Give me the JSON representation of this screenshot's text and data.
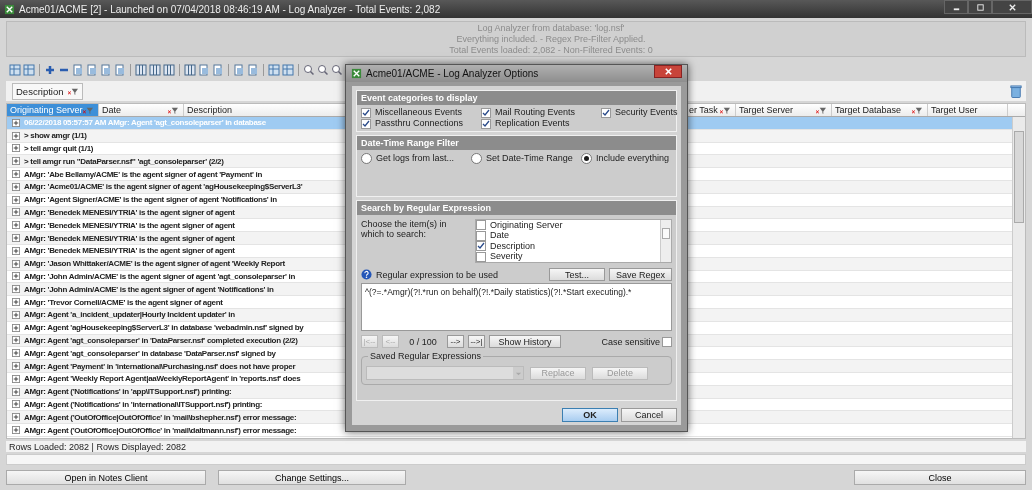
{
  "window": {
    "title": "Acme01/ACME [2] - Launched on 07/04/2018 08:46:19 AM - Log Analyzer - Total Events: 2,082"
  },
  "info": [
    "Log Analyzer from database: 'log.nsf'",
    "Everything included. - Regex Pre-Filter Applied.",
    "Total Events loaded: 2,082 - Non-Filtered Events: 0"
  ],
  "group_by": {
    "label": "Description"
  },
  "columns": [
    {
      "label": "Originating Server",
      "selected": true
    },
    {
      "label": "Date",
      "selected": false
    },
    {
      "label": "Description",
      "selected": false
    },
    {
      "label": "er Task",
      "selected": false
    },
    {
      "label": "Target Server",
      "selected": false
    },
    {
      "label": "Target Database",
      "selected": false
    },
    {
      "label": "Target User",
      "selected": false
    }
  ],
  "rows": [
    {
      "text": "06/22/2018 05:57:57 AM  AMgr: Agent 'agt_consoleparser' in database",
      "selected": true
    },
    {
      "text": "> show amgr (1/1)",
      "selected": false
    },
    {
      "text": "> tell amgr quit (1/1)",
      "selected": false
    },
    {
      "text": "> tell amgr run \"DataParser.nsf\" 'agt_consoleparser' (2/2)",
      "selected": false
    },
    {
      "text": "AMgr: 'Abe Bellamy/ACME' is the agent signer of agent 'Payment' in",
      "selected": false
    },
    {
      "text": "AMgr: 'Acme01/ACME' is the agent signer of agent 'agHousekeeping$ServerL3'",
      "selected": false
    },
    {
      "text": "AMgr: 'Agent Signer/ACME' is the agent signer of agent 'Notifications' in",
      "selected": false
    },
    {
      "text": "AMgr: 'Benedek MENESI/YTRIA' is the agent signer of agent",
      "selected": false
    },
    {
      "text": "AMgr: 'Benedek MENESI/YTRIA' is the agent signer of agent",
      "selected": false
    },
    {
      "text": "AMgr: 'Benedek MENESI/YTRIA' is the agent signer of agent",
      "selected": false
    },
    {
      "text": "AMgr: 'Benedek MENESI/YTRIA' is the agent signer of agent",
      "selected": false
    },
    {
      "text": "AMgr: 'Jason Whittaker/ACME' is the agent signer of agent 'Weekly Report",
      "selected": false
    },
    {
      "text": "AMgr: 'John Admin/ACME' is the agent signer of agent 'agt_consoleparser' in",
      "selected": false
    },
    {
      "text": "AMgr: 'John Admin/ACME' is the agent signer of agent 'Notifications' in",
      "selected": false
    },
    {
      "text": "AMgr: 'Trevor Cornell/ACME' is the agent signer of agent",
      "selected": false
    },
    {
      "text": "AMgr: Agent 'a_incident_updater|Hourly Incident updater' in",
      "selected": false
    },
    {
      "text": "AMgr: Agent 'agHousekeeping$ServerL3' in database 'webadmin.nsf' signed by",
      "selected": false
    },
    {
      "text": "AMgr: Agent 'agt_consoleparser' in 'DataParser.nsf' completed execution (2/2)",
      "selected": false
    },
    {
      "text": "AMgr: Agent 'agt_consoleparser' in database 'DataParser.nsf' signed by",
      "selected": false
    },
    {
      "text": "AMgr: Agent 'Payment' in 'international\\Purchasing.nsf' does not have proper",
      "selected": false
    },
    {
      "text": "AMgr: Agent 'Weekly Report Agent|aaWeeklyReportAgent' in 'reports.nsf' does",
      "selected": false
    },
    {
      "text": "AMgr: Agent ('Notifications' in 'app\\ITSupport.nsf') printing:",
      "selected": false
    },
    {
      "text": "AMgr: Agent ('Notifications' in 'international\\ITSupport.nsf') printing:",
      "selected": false
    },
    {
      "text": "AMgr: Agent ('OutOfOffice|OutOfOffice' in 'mail\\bshepher.nsf') error message:",
      "selected": false
    },
    {
      "text": "AMgr: Agent ('OutOfOffice|OutOfOffice' in 'mail\\daltmann.nsf') error message:",
      "selected": false
    }
  ],
  "status": "Rows Loaded: 2082 | Rows Displayed: 2082",
  "buttons": [
    "Open in Notes Client",
    "Change Settings...",
    "Close"
  ],
  "dialog": {
    "title": "Acme01/ACME - Log Analyzer Options",
    "categories": {
      "title": "Event categories to display",
      "items": [
        {
          "label": "Miscellaneous Events",
          "checked": true
        },
        {
          "label": "Mail Routing Events",
          "checked": true
        },
        {
          "label": "Security Events",
          "checked": true
        },
        {
          "label": "Passthru Connections",
          "checked": true
        },
        {
          "label": "Replication Events",
          "checked": true
        }
      ]
    },
    "date_filter": {
      "title": "Date-Time Range Filter",
      "options": [
        {
          "label": "Get logs from last...",
          "selected": false
        },
        {
          "label": "Set Date-Time Range",
          "selected": false
        },
        {
          "label": "Include everything",
          "selected": true
        }
      ]
    },
    "regex": {
      "title": "Search by Regular Expression",
      "choose_label": "Choose the item(s) in which to search:",
      "fields": [
        {
          "label": "Originating Server",
          "checked": false
        },
        {
          "label": "Date",
          "checked": false
        },
        {
          "label": "Description",
          "checked": true
        },
        {
          "label": "Severity",
          "checked": false
        }
      ],
      "expression_label": "Regular expression to be used",
      "test_button": "Test...",
      "save_button": "Save Regex",
      "expression": "^(?=.*Amgr)(?!.*run on behalf)(?!.*Daily statistics)(?!.*Start executing).*",
      "nav": [
        {
          "label": "|<--",
          "disabled": true
        },
        {
          "label": "<--",
          "disabled": true
        },
        {
          "label": "-->",
          "disabled": false
        },
        {
          "label": "-->|",
          "disabled": false
        }
      ],
      "counter": "0 / 100",
      "history_button": "Show History",
      "case_sensitive": {
        "label": "Case sensitive",
        "checked": false
      },
      "saved": {
        "title": "Saved Regular Expressions",
        "buttons": [
          {
            "label": "Replace",
            "disabled": true
          },
          {
            "label": "Delete",
            "disabled": true
          }
        ]
      }
    },
    "buttons": [
      {
        "label": "OK",
        "default": true
      },
      {
        "label": "Cancel",
        "default": false
      }
    ]
  }
}
